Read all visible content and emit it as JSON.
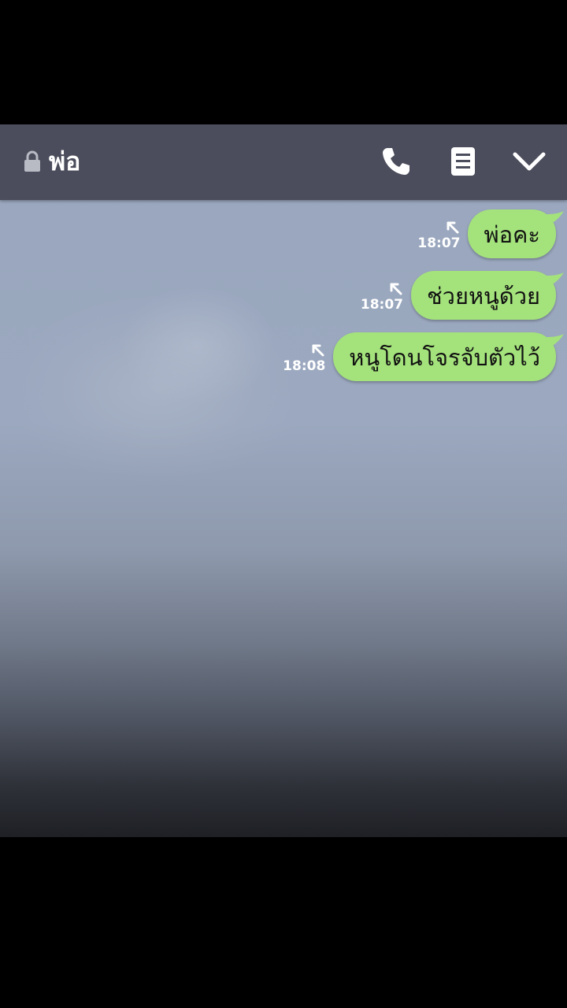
{
  "header": {
    "title": "พ่อ",
    "lock_icon": "lock-icon",
    "call_icon": "phone-icon",
    "notes_icon": "notes-icon",
    "collapse_icon": "chevron-down-icon",
    "background_color": "#4b4d5c"
  },
  "messages": [
    {
      "text": "พ่อคะ",
      "time": "18:07",
      "status_icon": "read-arrow-icon"
    },
    {
      "text": "ช่วยหนูด้วย",
      "time": "18:07",
      "status_icon": "read-arrow-icon"
    },
    {
      "text": "หนูโดนโจรจับตัวไว้",
      "time": "18:08",
      "status_icon": "read-arrow-icon"
    }
  ],
  "colors": {
    "bubble": "#a4e27c",
    "text": "#111111",
    "time": "#ffffff"
  }
}
